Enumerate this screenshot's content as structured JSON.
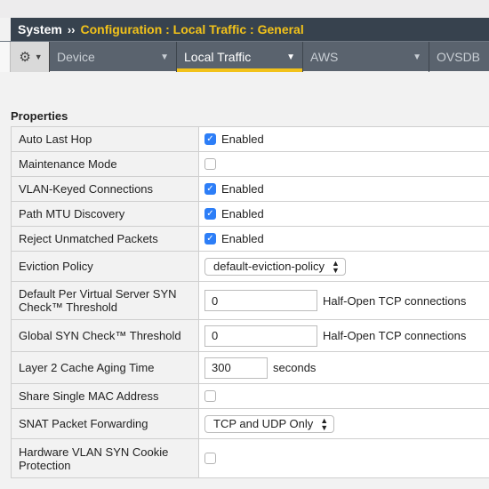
{
  "breadcrumb": {
    "system": "System",
    "separator": "››",
    "path": "Configuration : Local Traffic : General"
  },
  "nav": {
    "tabs": [
      {
        "label": "Device"
      },
      {
        "label": "Local Traffic",
        "active": true
      },
      {
        "label": "AWS"
      },
      {
        "label": "OVSDB"
      }
    ]
  },
  "section": {
    "title": "Properties"
  },
  "rows": [
    {
      "label": "Auto Last Hop",
      "checkbox": true,
      "value": "Enabled"
    },
    {
      "label": "Maintenance Mode",
      "checkbox": false
    },
    {
      "label": "VLAN-Keyed Connections",
      "checkbox": true,
      "value": "Enabled"
    },
    {
      "label": "Path MTU Discovery",
      "checkbox": true,
      "value": "Enabled"
    },
    {
      "label": "Reject Unmatched Packets",
      "checkbox": true,
      "value": "Enabled"
    },
    {
      "label": "Eviction Policy",
      "select": "default-eviction-policy"
    },
    {
      "label": "Default Per Virtual Server SYN Check™ Threshold",
      "input": "0",
      "unit": "Half-Open TCP connections"
    },
    {
      "label": "Global SYN Check™ Threshold",
      "input": "0",
      "unit": "Half-Open TCP connections"
    },
    {
      "label": "Layer 2 Cache Aging Time",
      "input": "300",
      "unit": "seconds"
    },
    {
      "label": "Share Single MAC Address",
      "checkbox": false
    },
    {
      "label": "SNAT Packet Forwarding",
      "select": "TCP and UDP Only"
    },
    {
      "label": "Hardware VLAN SYN Cookie Protection",
      "checkbox": false
    }
  ],
  "colors": {
    "title_bg": "#37424e",
    "accent": "#f2c21a",
    "nav_bg": "#5a636e",
    "checkbox_on": "#2d7ef7"
  },
  "icons": [
    "gear-icon",
    "chevron-down-icon",
    "checkbox-checked-icon",
    "select-arrows-icon"
  ]
}
